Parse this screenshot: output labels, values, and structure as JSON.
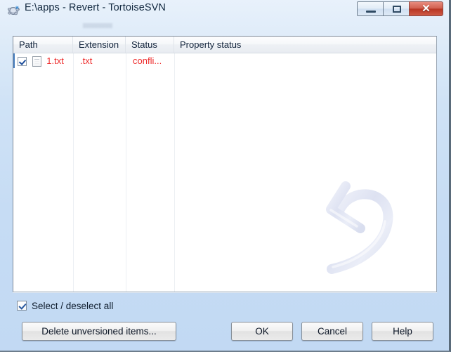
{
  "window": {
    "title": "E:\\apps - Revert - TortoiseSVN",
    "icon": "tortoise-turtle-icon",
    "controls": {
      "minimize": "minimize-icon",
      "maximize": "maximize-icon",
      "close": "✕"
    }
  },
  "list": {
    "columns": [
      "Path",
      "Extension",
      "Status",
      "Property status"
    ],
    "rows": [
      {
        "checked": true,
        "icon": "text-file-icon",
        "path": "1.txt",
        "extension": ".txt",
        "status": "confli...",
        "property_status": ""
      }
    ]
  },
  "watermark": {
    "icon": "revert-undo-arrow-icon"
  },
  "footer": {
    "select_all_label": "Select / deselect all",
    "select_all_checked": true,
    "delete_unversioned_label": "Delete unversioned items...",
    "ok_label": "OK",
    "cancel_label": "Cancel",
    "help_label": "Help"
  },
  "colors": {
    "dialog_background": "#c8dff5",
    "title_text": "#12283f",
    "conflict_red": "#ee2b2b",
    "close_button": "#c04a36",
    "selection_marker": "#4a80c0",
    "watermark": "#ccd2ec"
  }
}
